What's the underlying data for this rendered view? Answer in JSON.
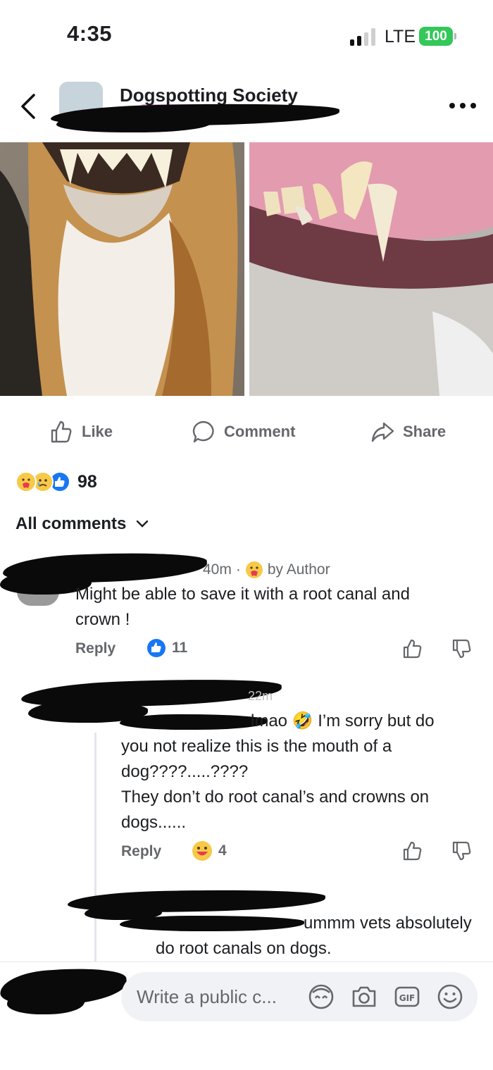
{
  "status_bar": {
    "time": "4:35",
    "network": "LTE",
    "battery": "100"
  },
  "header": {
    "group_name": "Dogspotting Society",
    "back_icon": "chevron-left-icon",
    "more_icon": "more-horizontal-icon"
  },
  "post_actions": {
    "like": "Like",
    "comment": "Comment",
    "share": "Share"
  },
  "reactions": {
    "count": "98",
    "icons": [
      "care-emoji",
      "sad-emoji",
      "like-emoji"
    ]
  },
  "comments_filter": {
    "label": "All comments"
  },
  "comments": [
    {
      "time": "40m",
      "separator": "·",
      "badge": "by Author",
      "text_lines": [
        "Might be able to save it with a root canal and",
        "crown !"
      ],
      "reply": "Reply",
      "like_count": "11"
    },
    {
      "time": "22m",
      "text_lines": [
        "lmao 🤣 I’m sorry but do",
        "you not realize this is the mouth of a",
        "dog????.....????",
        "They don’t do root canal’s and crowns on",
        "dogs......"
      ],
      "reply": "Reply",
      "reaction_count": "4"
    },
    {
      "text_lines": [
        "ummm vets absolutely",
        "do root canals on dogs."
      ]
    }
  ],
  "composer": {
    "placeholder": "Write a public c..."
  },
  "colors": {
    "like_blue": "#1877f2",
    "battery_green": "#34c759",
    "meta_gray": "#65676b",
    "highlight_pink": "#e6a3e8"
  }
}
